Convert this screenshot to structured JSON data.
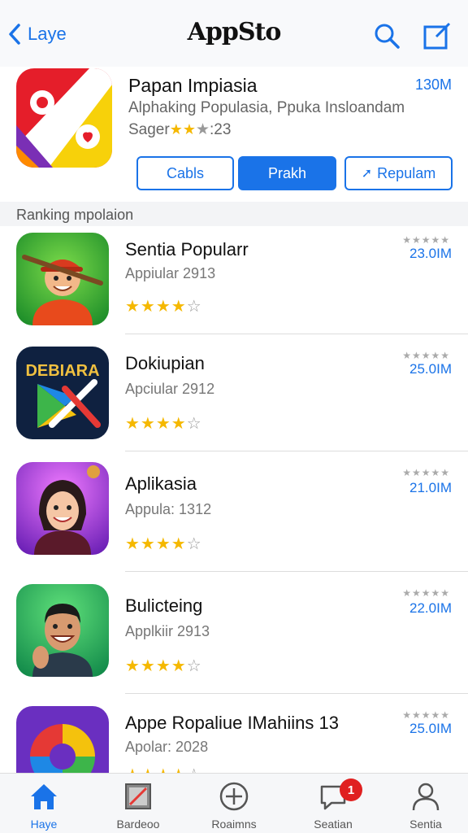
{
  "nav": {
    "back_label": "Laye",
    "title": "AppSto"
  },
  "featured": {
    "title": "Papan Impiasia",
    "size": "130M",
    "subtitle": "Alphaking Populasia, Ppuka Insloandam",
    "rating_prefix": "Sager",
    "rating_stars": "★★",
    "rating_half": "★",
    "rating_value": ":23",
    "buttons": {
      "b1": "Cabls",
      "b2": "Prakh",
      "b3": "Repulam"
    }
  },
  "section": {
    "label": "Ranking mpolaion"
  },
  "apps": [
    {
      "name": "Sentia Popularr",
      "category": "Appiular 2913",
      "rating": 4,
      "mini_stars": "★★★★★",
      "size": "23.0IM"
    },
    {
      "name": "Dokiupian",
      "category": "Apciular 2912",
      "rating": 4,
      "mini_stars": "★★★★★",
      "size": "25.0IM"
    },
    {
      "name": "Aplikasia",
      "category": "Appula: 1312",
      "rating": 4,
      "mini_stars": "★★★★★",
      "size": "21.0IM"
    },
    {
      "name": "Bulicteing",
      "category": "Applkiir 2913",
      "rating": 4,
      "mini_stars": "★★★★★",
      "size": "22.0IM"
    },
    {
      "name": "Appe Ropaliue IMahiins 13",
      "category": "Apolar: 2028",
      "rating": 4,
      "mini_stars": "★★★★★",
      "size": "25.0IM"
    }
  ],
  "tabs": [
    {
      "label": "Haye"
    },
    {
      "label": "Bardeoo"
    },
    {
      "label": "Roaimns"
    },
    {
      "label": "Seatian",
      "badge": "1"
    },
    {
      "label": "Sentia"
    }
  ],
  "colors": {
    "accent": "#1a73e8",
    "star": "#f5b800",
    "badge": "#e02020"
  }
}
